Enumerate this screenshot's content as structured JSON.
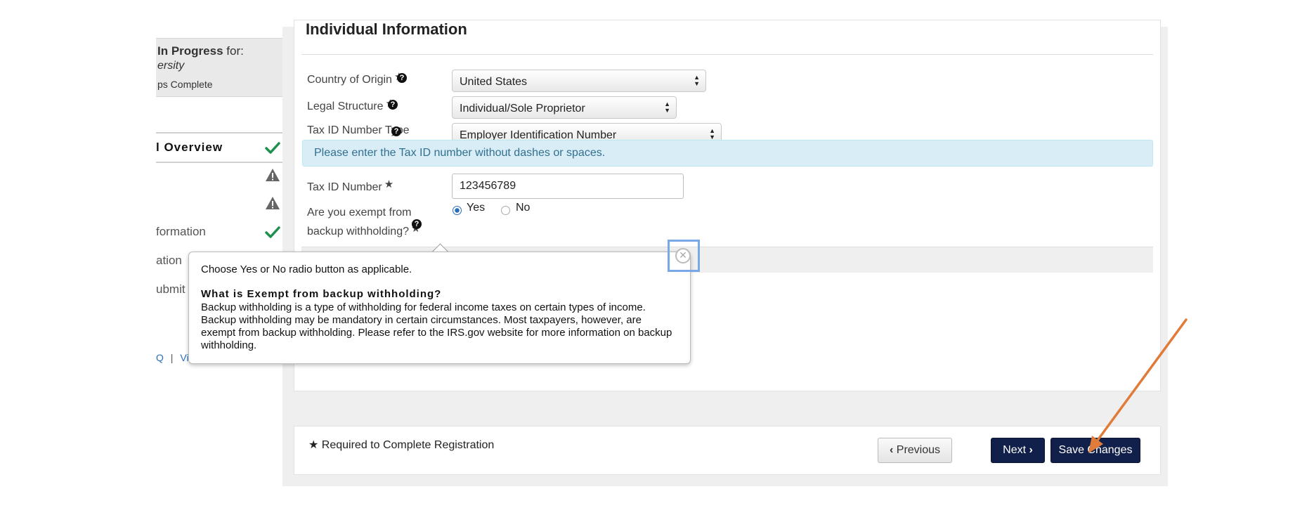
{
  "sidebar": {
    "progress_title_bold": "In Progress",
    "progress_title_rest": " for:",
    "progress_subtitle": "ersity",
    "progress_steps": "ps Complete",
    "items": [
      {
        "label": "l Overview",
        "status": "complete"
      },
      {
        "label": "",
        "status": "warning"
      },
      {
        "label": "",
        "status": "warning"
      },
      {
        "label": "formation",
        "status": "complete"
      },
      {
        "label": "ation",
        "status": ""
      },
      {
        "label": "ubmit",
        "status": ""
      }
    ],
    "links_prefix": "Q",
    "links_separator": "|",
    "link_view": "View"
  },
  "form": {
    "section_title": "Individual Information",
    "country_label": "Country of Origin",
    "country_value": "United States",
    "legal_label": "Legal Structure",
    "legal_value": "Individual/Sole Proprietor",
    "taxtype_label": "Tax ID Number Type",
    "taxtype_value": "Employer Identification Number",
    "info_message": "Please enter the Tax ID number without dashes or spaces.",
    "taxid_label": "Tax ID Number",
    "taxid_value": "123456789",
    "exempt_label_line1": "Are you exempt from",
    "exempt_label_line2": "backup withholding?",
    "yes_label": "Yes",
    "no_label": "No",
    "exempt_selected": "Yes"
  },
  "popover": {
    "line1": "Choose Yes or No radio button as applicable.",
    "heading": "What is Exempt from backup withholding?",
    "body": "Backup withholding is a type of withholding for federal income taxes on certain types of income. Backup withholding may be mandatory in certain circumstances. Most taxpayers, however, are exempt from backup withholding. Please refer to the IRS.gov website for more information on backup withholding."
  },
  "footer": {
    "required_note": "Required to Complete Registration",
    "previous_label": "Previous",
    "next_label": "Next",
    "save_label": "Save Changes"
  },
  "glyphs": {
    "star": "★",
    "help": "?",
    "close": "✕",
    "prev_chevron": "‹",
    "next_chevron": "›",
    "select_arrows": "▲▼"
  },
  "colors": {
    "complete_check": "#1e8f4e",
    "warning_icon": "#666666",
    "primary_button": "#10204a",
    "info_bg": "#d9edf7",
    "annotation_arrow": "#e07b39"
  }
}
